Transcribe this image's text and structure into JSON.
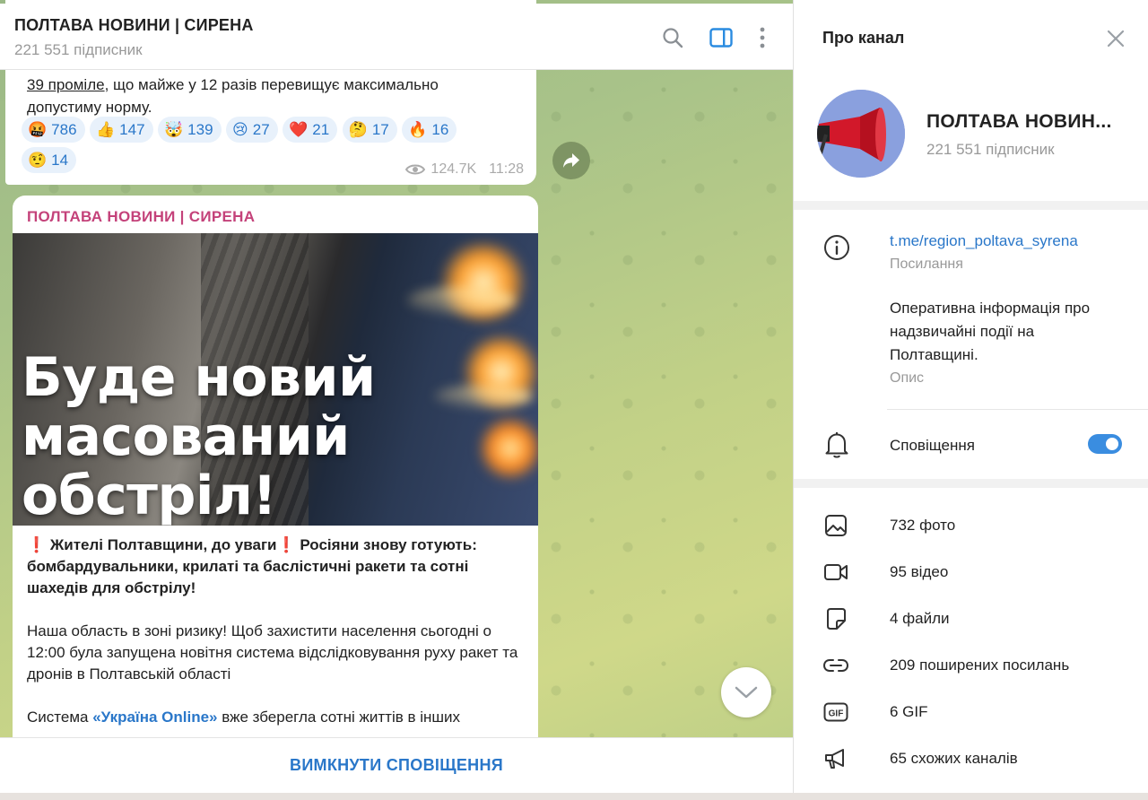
{
  "chat": {
    "title": "ПОЛТАВА НОВИНИ | СИРЕНА",
    "subscribers": "221 551 підписник",
    "mute_button": "ВИМКНУТИ СПОВІЩЕННЯ"
  },
  "message1": {
    "text_line1_part1": "39 проміле",
    "text_line1_part2": ", що майже у 12 разів перевищує максимально",
    "text_line2": "допустиму норму.",
    "reactions": [
      {
        "emoji": "🤬",
        "count": "786"
      },
      {
        "emoji": "👍",
        "count": "147"
      },
      {
        "emoji": "🤯",
        "count": "139"
      },
      {
        "emoji": "😢",
        "count": "27"
      },
      {
        "emoji": "❤️",
        "count": "21"
      },
      {
        "emoji": "🤔",
        "count": "17"
      },
      {
        "emoji": "🔥",
        "count": "16"
      },
      {
        "emoji": "🤨",
        "count": "14"
      }
    ],
    "views": "124.7K",
    "time": "11:28"
  },
  "message2": {
    "author": "ПОЛТАВА НОВИНИ | СИРЕНА",
    "photo_headline": [
      "Буде новий",
      "масований",
      "обстріл!"
    ],
    "p1_warn1": "❗",
    "p1_a": " Жителі Полтавщини, до уваги",
    "p1_warn2": "❗",
    "p1_b": "  Росіяни знову готують: бомбардувальники, крилаті та баслістичні ракети та сотні шахедів для обстрілу!",
    "p2": "Наша область в зоні ризику! Щоб захистити населення сьогодні о 12:00  була запущена новітня система відслідковування руху ракет та дронів в Полтавській області",
    "p3_a": "Система ",
    "p3_link": "«Україна Online»",
    "p3_b": " вже зберегла сотні життів в інших"
  },
  "panel": {
    "title": "Про канал",
    "channel_name": "ПОЛТАВА НОВИН...",
    "subscribers": "221 551 підписник",
    "link": "t.me/region_poltava_syrena",
    "link_label": "Посилання",
    "description": [
      "Оперативна інформація про",
      "надзвичайні події на",
      "Полтавщині."
    ],
    "description_label": "Опис",
    "notifications": "Сповіщення",
    "notifications_on": true,
    "media": [
      {
        "icon": "photo-icon",
        "label": "732 фото"
      },
      {
        "icon": "video-icon",
        "label": "95 відео"
      },
      {
        "icon": "file-icon",
        "label": "4 файли"
      },
      {
        "icon": "link-icon",
        "label": "209 поширених посилань"
      },
      {
        "icon": "gif-icon",
        "label": "6 GIF"
      },
      {
        "icon": "megaphone-icon",
        "label": "65 схожих каналів"
      }
    ]
  },
  "colors": {
    "accent": "#2a77c9",
    "author": "#c4427a",
    "toggle": "#3a8de0"
  }
}
